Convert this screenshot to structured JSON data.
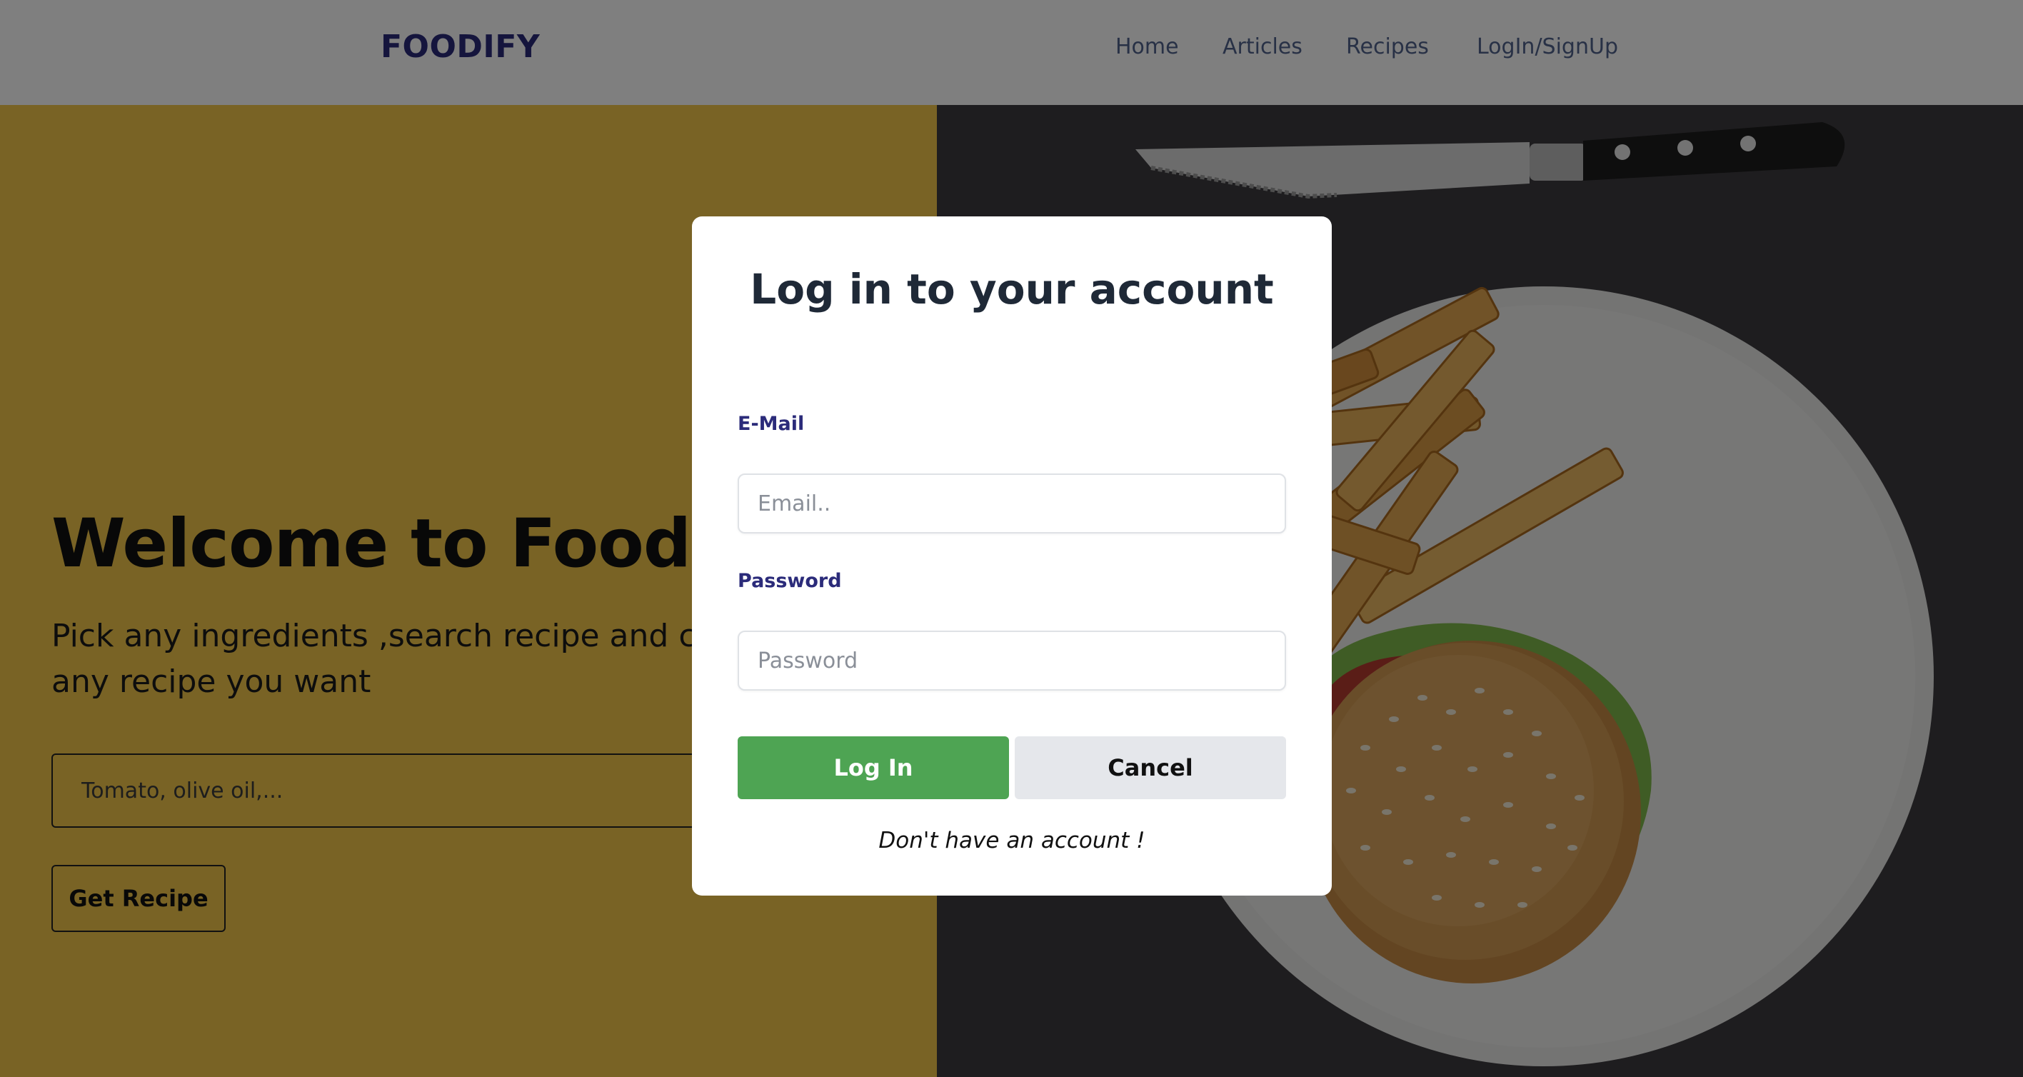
{
  "navbar": {
    "brand": "FOODIFY",
    "links": [
      "Home",
      "Articles",
      "Recipes",
      "LogIn/SignUp"
    ]
  },
  "hero": {
    "title": "Welcome to Foodify!",
    "subtitle": "Pick any ingredients ,search recipe and ch any recipe you want",
    "search_placeholder": "Tomato, olive oil,...",
    "get_recipe_label": "Get Recipe"
  },
  "modal": {
    "title": "Log in to your account",
    "email_label": "E-Mail",
    "email_placeholder": "Email..",
    "password_label": "Password",
    "password_placeholder": "Password",
    "login_label": "Log In",
    "cancel_label": "Cancel",
    "signup_text": "Don't have an account !"
  },
  "colors": {
    "brand": "#2b2b7a",
    "hero_yellow": "#f3c74b",
    "login_button": "#4ea453",
    "cancel_button": "#e5e7eb",
    "overlay": "rgba(0,0,0,0.5)"
  }
}
